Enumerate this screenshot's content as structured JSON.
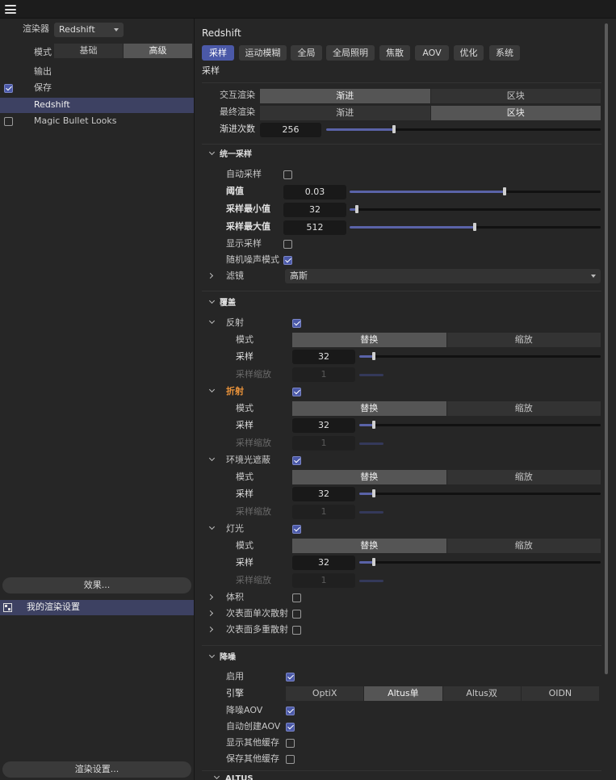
{
  "left": {
    "renderer_label": "渲染器",
    "renderer_value": "Redshift",
    "mode_label": "模式",
    "mode_options": [
      "基础",
      "高级"
    ],
    "tree": [
      {
        "label": "输出",
        "checked": null
      },
      {
        "label": "保存",
        "checked": true
      },
      {
        "label": "Redshift",
        "checked": null,
        "selected": true
      },
      {
        "label": "Magic Bullet Looks",
        "checked": false
      }
    ],
    "effects_button": "效果...",
    "preset_label": "我的渲染设置",
    "render_settings_button": "渲染设置..."
  },
  "right": {
    "title": "Redshift",
    "tabs": [
      "采样",
      "运动模糊",
      "全局",
      "全局照明",
      "焦散",
      "AOV",
      "优化",
      "系统"
    ],
    "section_title": "采样",
    "interactive_label": "交互渲染",
    "final_label": "最终渲染",
    "seg_options": [
      "渐进",
      "区块"
    ],
    "progressive_label": "渐进次数",
    "progressive_value": "256",
    "unified": {
      "title": "统一采样",
      "auto_label": "自动采样",
      "threshold_label": "阈值",
      "threshold_value": "0.03",
      "min_label": "采样最小值",
      "min_value": "32",
      "max_label": "采样最大值",
      "max_value": "512",
      "show_label": "显示采样",
      "random_label": "随机噪声模式",
      "filter_label": "滤镜",
      "filter_value": "高斯"
    },
    "override": {
      "title": "覆盖",
      "mode_label": "模式",
      "samples_label": "采样",
      "scale_label": "采样缩放",
      "mode_options": [
        "替换",
        "缩放"
      ],
      "groups": [
        {
          "label": "反射",
          "samples": "32",
          "scale": "1"
        },
        {
          "label": "折射",
          "samples": "32",
          "scale": "1"
        },
        {
          "label": "环境光遮蔽",
          "samples": "32",
          "scale": "1"
        },
        {
          "label": "灯光",
          "samples": "32",
          "scale": "1"
        }
      ],
      "volume_label": "体积",
      "sss_single_label": "次表面单次散射",
      "sss_multi_label": "次表面多重散射"
    },
    "denoise": {
      "title": "降噪",
      "enable_label": "启用",
      "engine_label": "引擎",
      "engine_options": [
        "OptiX",
        "Altus单",
        "Altus双",
        "OIDN"
      ],
      "aov_label": "降噪AOV",
      "auto_aov_label": "自动创建AOV",
      "show_other_label": "显示其他缓存",
      "save_other_label": "保存其他缓存"
    },
    "altus_title": "ALTUS"
  },
  "colors": {
    "accent": "#4b59a8",
    "selected_row": "#3d4162",
    "orange": "#e8923a"
  }
}
